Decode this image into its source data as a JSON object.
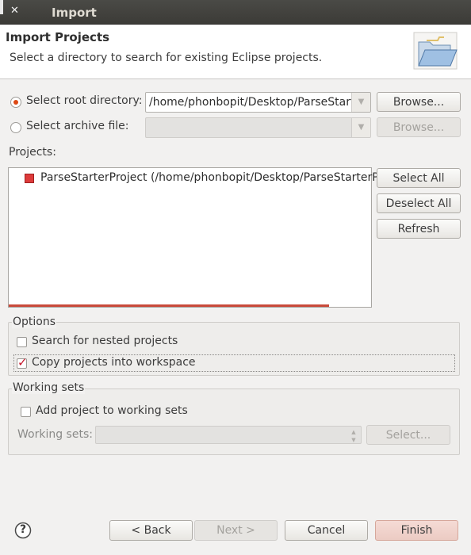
{
  "window": {
    "title": "Import",
    "close_glyph": "✕",
    "min_glyph": ""
  },
  "header": {
    "title": "Import Projects",
    "subtitle": "Select a directory to search for existing Eclipse projects.",
    "icon": "folder-open-icon"
  },
  "source": {
    "root_label": "Select root directory:",
    "root_value": "/home/phonbopit/Desktop/ParseStarterProject",
    "archive_label": "Select archive file:",
    "archive_value": "",
    "browse_label": "Browse...",
    "browse2_label": "Browse..."
  },
  "projects": {
    "label": "Projects:",
    "items": [
      {
        "label": "ParseStarterProject (/home/phonbopit/Desktop/ParseStarterProject)",
        "checked": true
      }
    ],
    "select_all": "Select All",
    "deselect_all": "Deselect All",
    "refresh": "Refresh"
  },
  "options": {
    "title": "Options",
    "nested_label": "Search for nested projects",
    "nested_checked": false,
    "copy_label": "Copy projects into workspace",
    "copy_checked": true
  },
  "working_sets": {
    "title": "Working sets",
    "add_label": "Add project to working sets",
    "sets_label": "Working sets:",
    "select_label": "Select..."
  },
  "footer": {
    "help_glyph": "?",
    "back": "< Back",
    "next": "Next >",
    "cancel": "Cancel",
    "finish": "Finish"
  },
  "colors": {
    "accent": "#dd4814",
    "titlebar": "#3c3b37",
    "finish_bg": "#f2d3cc"
  }
}
